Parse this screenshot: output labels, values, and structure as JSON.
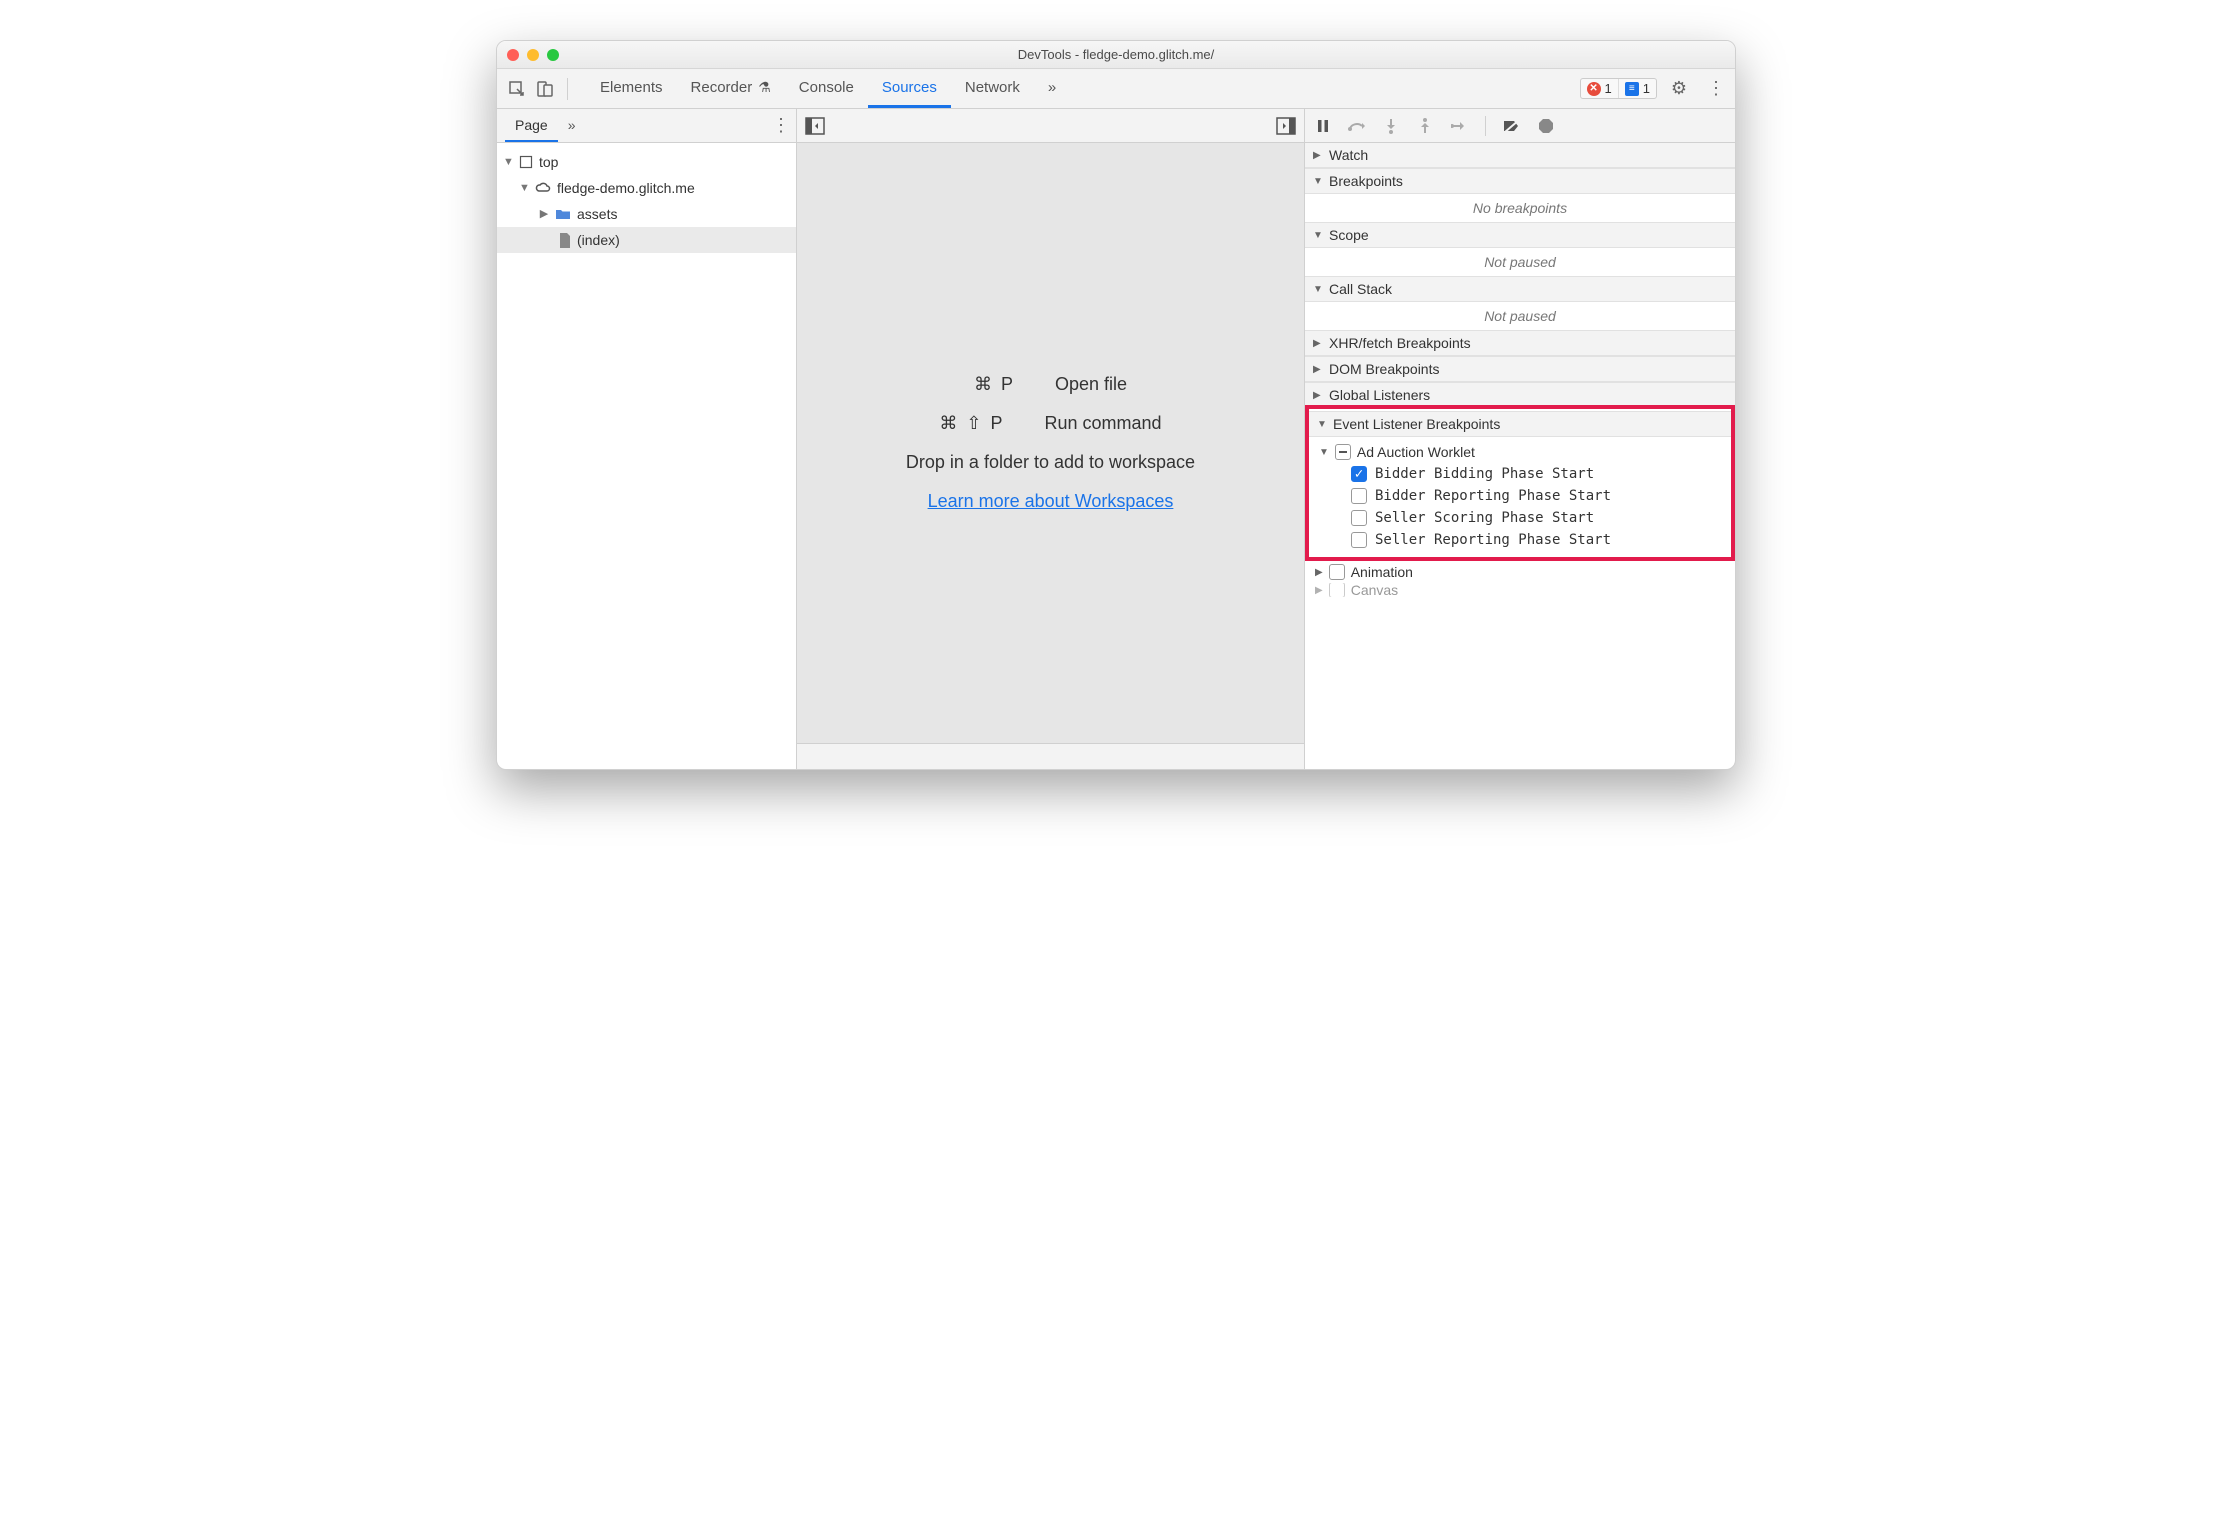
{
  "window": {
    "title": "DevTools - fledge-demo.glitch.me/"
  },
  "toolbar": {
    "tabs": [
      "Elements",
      "Recorder",
      "Console",
      "Sources",
      "Network"
    ],
    "active_tab": "Sources",
    "more_glyph": "»",
    "errors_count": "1",
    "messages_count": "1"
  },
  "left": {
    "tab": "Page",
    "more_glyph": "»",
    "tree": {
      "top": "top",
      "origin": "fledge-demo.glitch.me",
      "folder": "assets",
      "file": "(index)"
    }
  },
  "mid": {
    "open_file_keys": "⌘ P",
    "open_file_label": "Open file",
    "run_cmd_keys": "⌘ ⇧ P",
    "run_cmd_label": "Run command",
    "drop_text": "Drop in a folder to add to workspace",
    "learn_link": "Learn more about Workspaces"
  },
  "right": {
    "sections": {
      "watch": "Watch",
      "breakpoints": "Breakpoints",
      "breakpoints_empty": "No breakpoints",
      "scope": "Scope",
      "scope_empty": "Not paused",
      "callstack": "Call Stack",
      "callstack_empty": "Not paused",
      "xhr": "XHR/fetch Breakpoints",
      "dom": "DOM Breakpoints",
      "global": "Global Listeners",
      "elb": "Event Listener Breakpoints",
      "animation": "Animation",
      "canvas": "Canvas"
    },
    "ad_auction": {
      "group": "Ad Auction Worklet",
      "items": [
        "Bidder Bidding Phase Start",
        "Bidder Reporting Phase Start",
        "Seller Scoring Phase Start",
        "Seller Reporting Phase Start"
      ],
      "checked_index": 0
    }
  }
}
